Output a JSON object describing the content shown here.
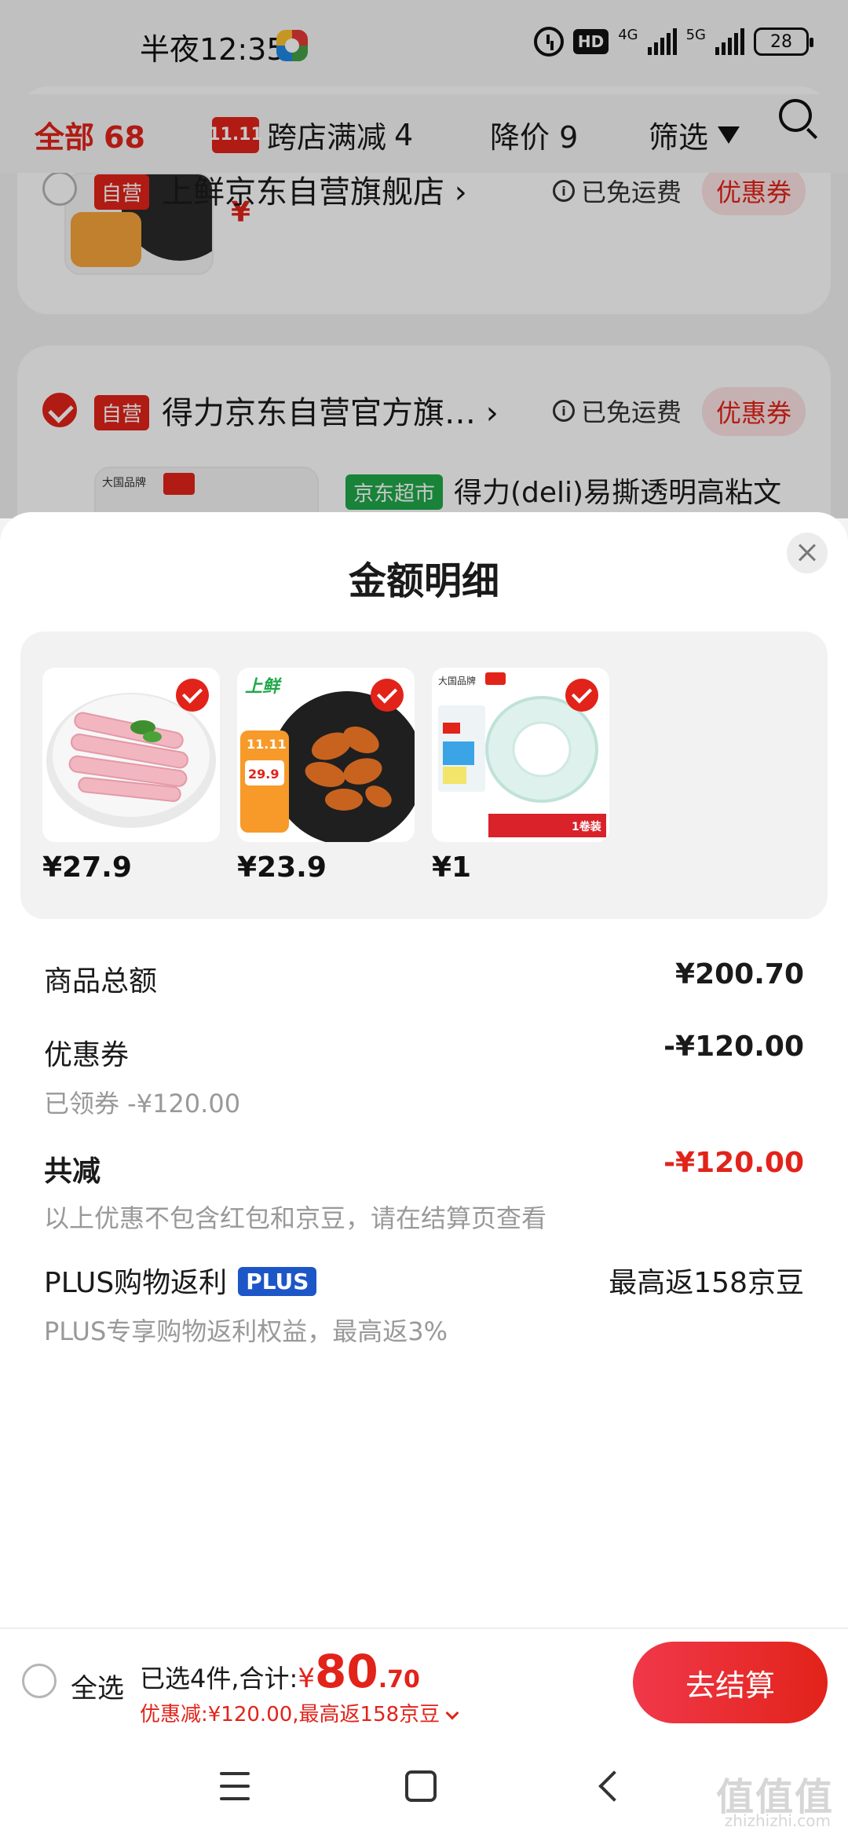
{
  "status_bar": {
    "time": "半夜12:35",
    "hd": "HD",
    "net1": "4G",
    "net2": "5G",
    "battery": "28"
  },
  "filter_bar": {
    "all_label": "全部",
    "all_count": "68",
    "promo_logo": "11.11",
    "promo_label": "跨店满减",
    "promo_count": "4",
    "price_label": "降价",
    "price_count": "9",
    "screen_label": "筛选"
  },
  "cart_bg": {
    "store1": {
      "tag": "自营",
      "name": "上鲜京东自营旗舰店",
      "chevron": "›",
      "ship": "已免运费",
      "coupon": "优惠券",
      "info": "i"
    },
    "store2": {
      "tag": "自营",
      "name": "得力京东自营官方旗…",
      "chevron": "›",
      "ship": "已免运费",
      "coupon": "优惠券",
      "market_tag": "京东超市",
      "product_title": "得力(deli)易撕透明高粘文"
    }
  },
  "sheet": {
    "title": "金额明细",
    "products": [
      {
        "price": "¥27.9"
      },
      {
        "price": "¥23.9",
        "logo": "上鲜",
        "badge_top": "11.11",
        "badge_price": "29.9"
      },
      {
        "price": "¥1",
        "label": "1卷装"
      }
    ],
    "rows": {
      "subtotal_label": "商品总额",
      "subtotal_value": "¥200.70",
      "coupon_label": "优惠券",
      "coupon_value": "-¥120.00",
      "coupon_sub": "已领券 -¥120.00",
      "total_discount_label": "共减",
      "total_discount_value": "-¥120.00",
      "total_discount_note": "以上优惠不包含红包和京豆，请在结算页查看",
      "plus_label": "PLUS购物返利",
      "plus_badge": "PLUS",
      "plus_value": "最高返158京豆",
      "plus_note": "PLUS专享购物返利权益，最高返3%"
    }
  },
  "bottom_bar": {
    "select_all": "全选",
    "summary_prefix": "已选4件,合计:",
    "yen": "¥",
    "amount_int": "80",
    "amount_dec": ".70",
    "discount_line": "优惠减:¥120.00,最高返158京豆",
    "checkout": "去结算"
  },
  "watermark": {
    "text": "值值值",
    "sub": "zhizhizhi.com"
  },
  "colors": {
    "brand_red": "#e2231a",
    "plus_blue": "#1d56c7",
    "market_green": "#1fa84a"
  }
}
